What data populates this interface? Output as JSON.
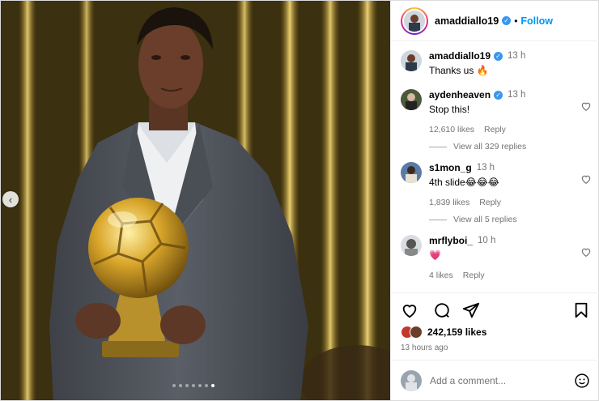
{
  "post": {
    "author": "amaddiallo19",
    "follow_label": "Follow",
    "separator": "•",
    "carousel": {
      "total_slides": 7,
      "active_index": 6
    },
    "caption": {
      "user": "amaddiallo19",
      "time": "13 h",
      "text": "Thanks us 🔥"
    },
    "likes": "242,159 likes",
    "time_ago": "13 hours ago",
    "comment_placeholder": "Add a comment..."
  },
  "comments": [
    {
      "user": "aydenheaven",
      "verified": true,
      "time": "13 h",
      "text": "Stop this!",
      "likes": "12,610 likes",
      "reply": "Reply",
      "view_replies": "View all 329 replies"
    },
    {
      "user": "s1mon_g",
      "verified": false,
      "time": "13 h",
      "text": "4th slide😂😂😂",
      "likes": "1,839 likes",
      "reply": "Reply",
      "view_replies": "View all 5 replies"
    },
    {
      "user": "mrflyboi_",
      "verified": false,
      "time": "10 h",
      "text": "💗",
      "likes": "4 likes",
      "reply": "Reply"
    }
  ],
  "icons": {
    "like": "heart-icon",
    "comment": "comment-icon",
    "share": "share-icon",
    "save": "bookmark-icon",
    "emoji": "smiley-icon",
    "prev": "chevron-left-icon",
    "verified": "verified-badge-icon"
  },
  "colors": {
    "accent": "#0095f6",
    "verified": "#3897f0",
    "muted": "#737373",
    "media_gold": "#d9b44a"
  }
}
